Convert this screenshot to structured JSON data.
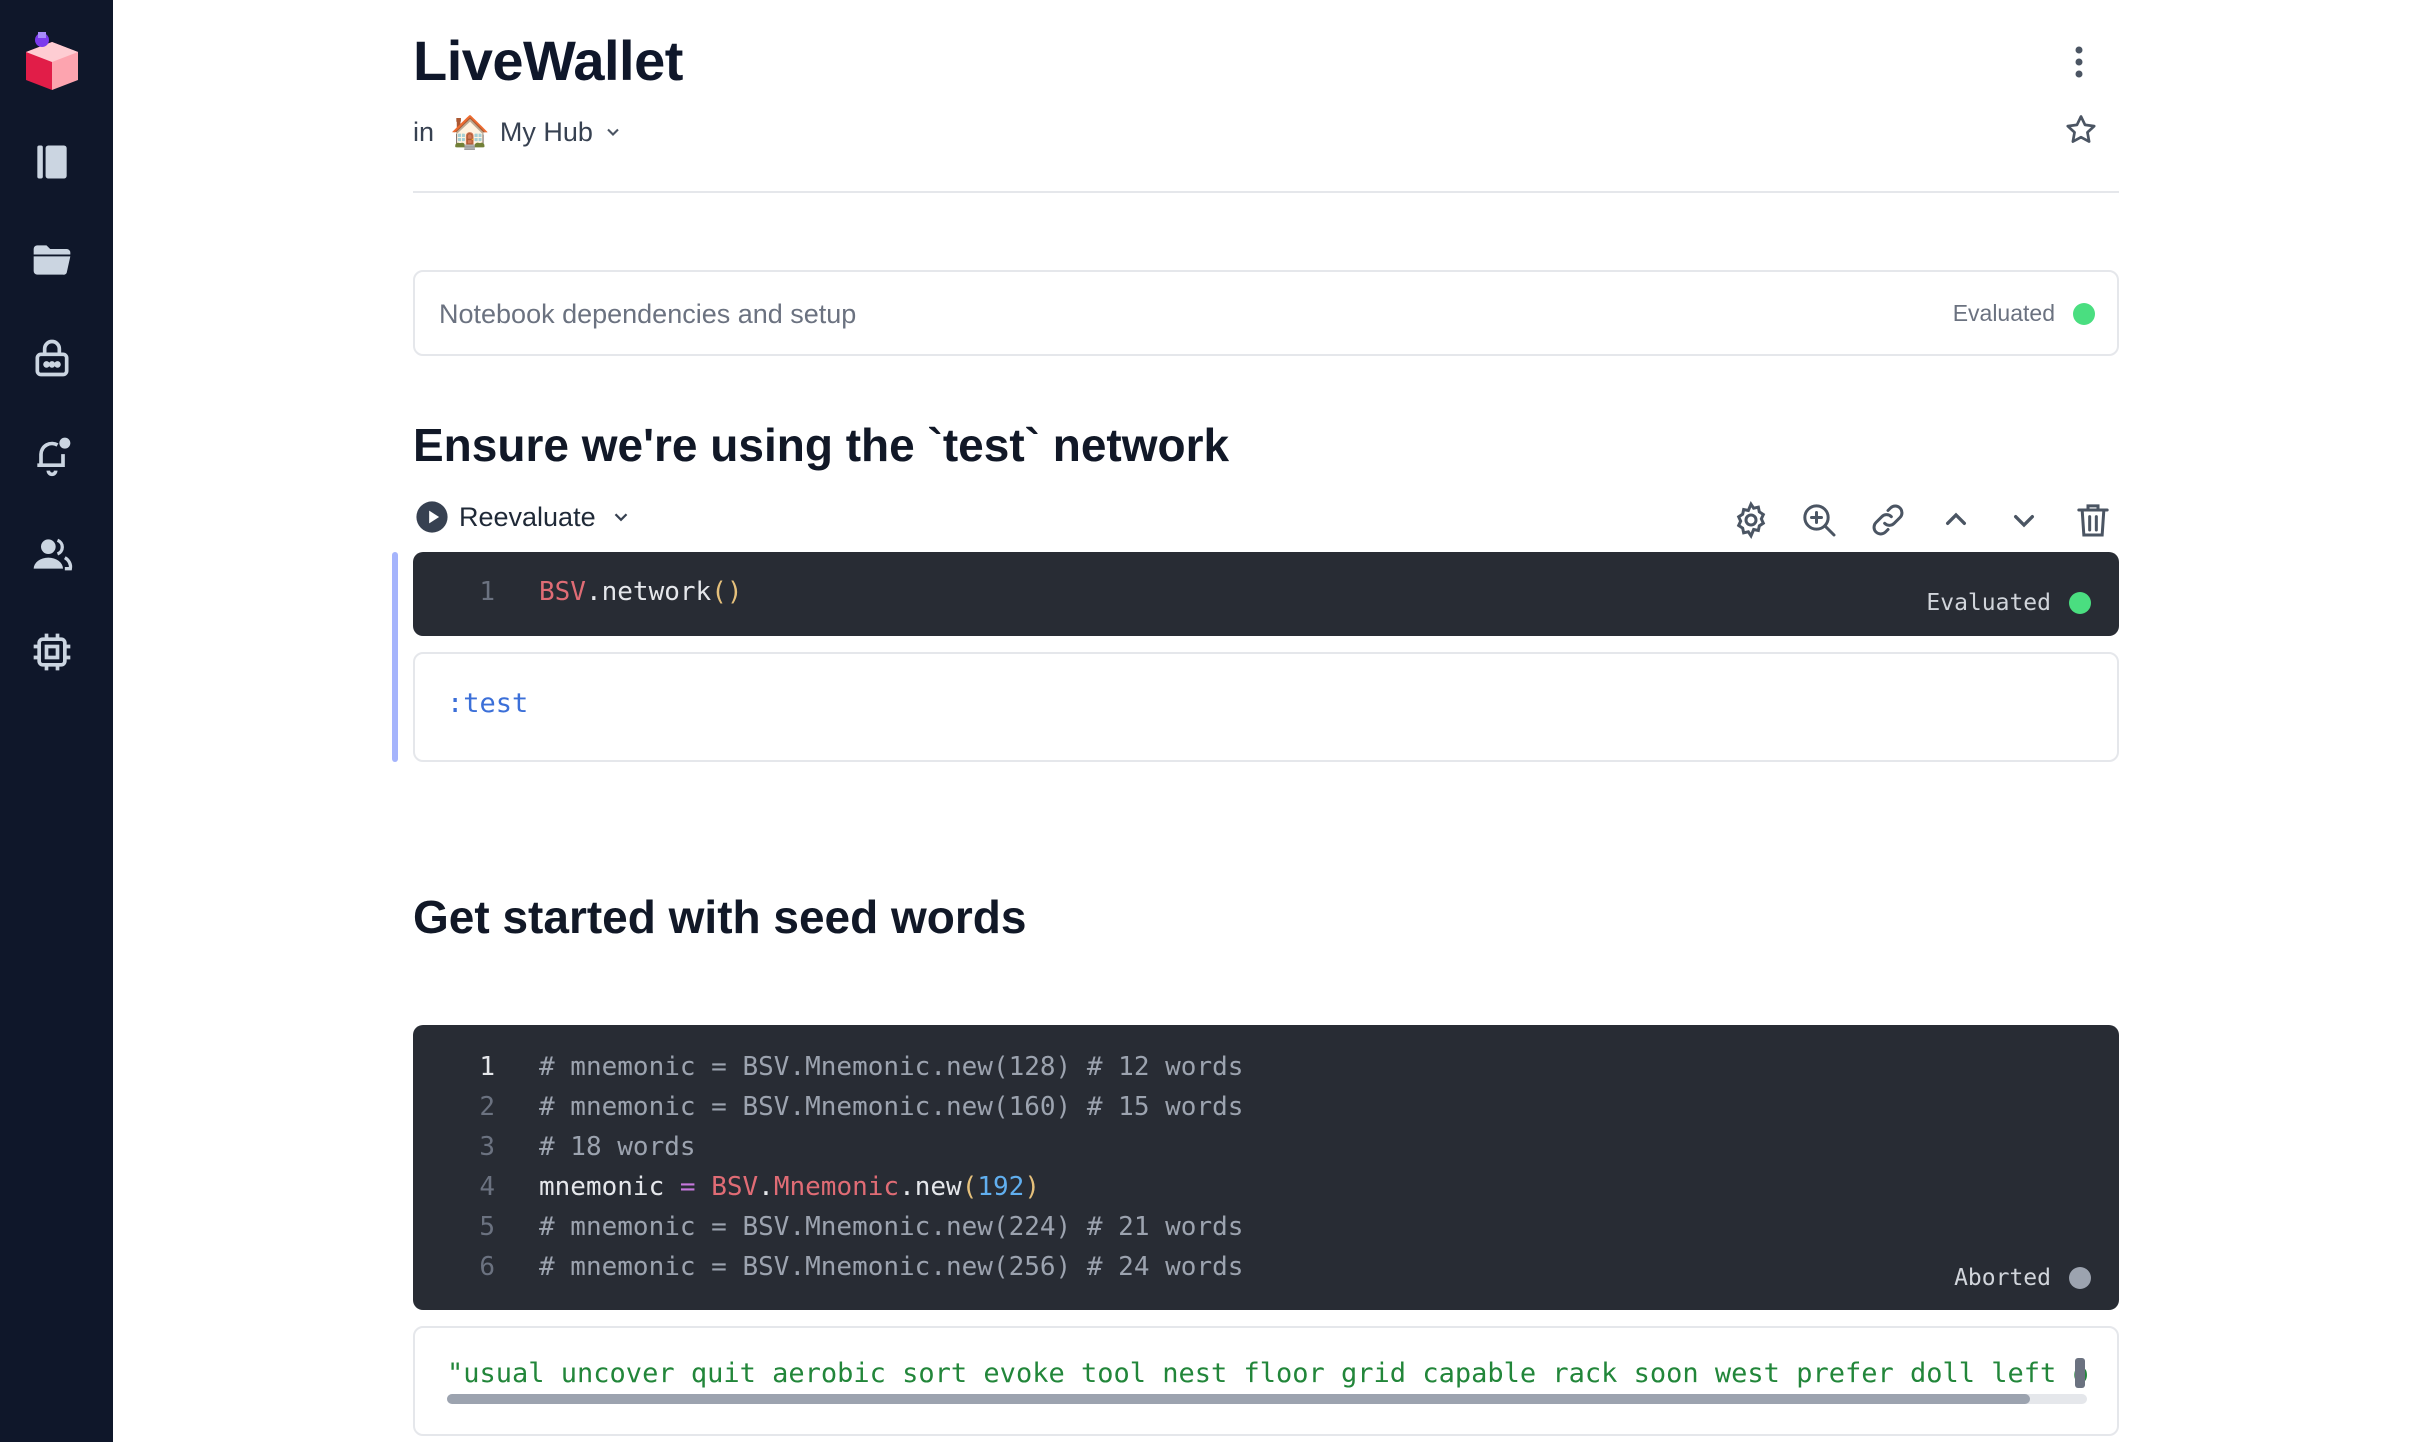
{
  "sidebar": {
    "items": [
      {
        "icon": "logo-icon"
      },
      {
        "icon": "notebook-icon"
      },
      {
        "icon": "folder-icon"
      },
      {
        "icon": "secrets-icon"
      },
      {
        "icon": "notifications-icon"
      },
      {
        "icon": "users-icon"
      },
      {
        "icon": "cpu-icon"
      }
    ]
  },
  "notebook": {
    "title": "LiveWallet",
    "hub_prefix": "in",
    "hub_emoji": "🏠",
    "hub_name": "My Hub"
  },
  "setup": {
    "label": "Notebook dependencies and setup",
    "status": "Evaluated",
    "status_color": "#4ade80"
  },
  "section1": {
    "heading": "Ensure we're using the `test` network",
    "reevaluate_label": "Reevaluate",
    "code_lines": [
      {
        "num": "1"
      }
    ],
    "status": "Evaluated",
    "status_color": "#4ade80",
    "output": ":test"
  },
  "section2": {
    "heading": "Get started with seed words",
    "code_lines": [
      {
        "num": "1",
        "text": "# mnemonic = BSV.Mnemonic.new(128) # 12 words"
      },
      {
        "num": "2",
        "text": "# mnemonic = BSV.Mnemonic.new(160) # 15 words"
      },
      {
        "num": "3",
        "text": "# 18 words"
      },
      {
        "num": "4"
      },
      {
        "num": "5",
        "text": "# mnemonic = BSV.Mnemonic.new(224) # 21 words"
      },
      {
        "num": "6",
        "text": "# mnemonic = BSV.Mnemonic.new(256) # 24 words"
      }
    ],
    "status": "Aborted",
    "status_color": "#9ca3af",
    "output": "\"usual uncover quit aerobic sort evoke tool nest floor grid capable rack soon west prefer doll left on"
  },
  "colors": {
    "sidebar_bg": "#0f172a",
    "code_bg": "#282c34",
    "accent": "#a5b4fc"
  }
}
